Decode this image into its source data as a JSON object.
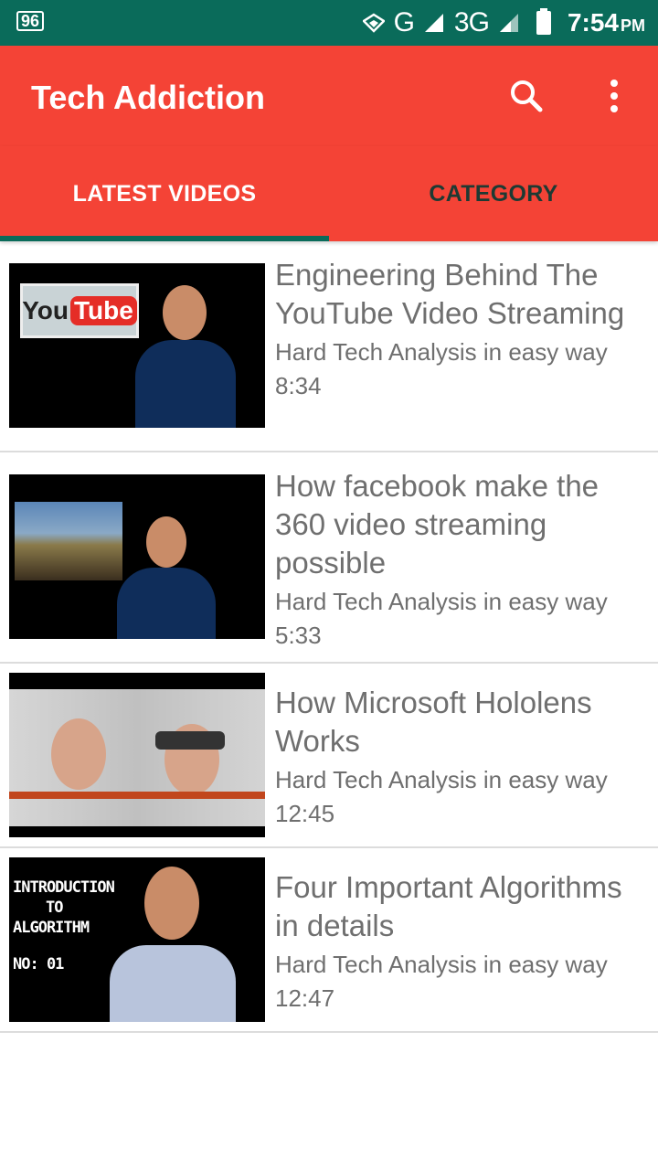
{
  "status_bar": {
    "notification": "96",
    "network_g": "G",
    "network_3g": "3G",
    "time": "7:54",
    "ampm": "PM"
  },
  "app_bar": {
    "title": "Tech Addiction",
    "icons": [
      "search-icon",
      "more-vert-icon"
    ]
  },
  "tabs": [
    {
      "label": "LATEST VIDEOS",
      "selected": true
    },
    {
      "label": "CATEGORY",
      "selected": false
    }
  ],
  "videos": [
    {
      "title": "Engineering Behind The YouTube Video Streaming",
      "channel": "Hard Tech Analysis in easy way",
      "duration": "8:34"
    },
    {
      "title": "How facebook make the 360 video streaming possible",
      "channel": "Hard Tech Analysis in easy way",
      "duration": "5:33"
    },
    {
      "title": "How Microsoft Hololens Works",
      "channel": "Hard Tech Analysis in easy way",
      "duration": "12:45"
    },
    {
      "title": "Four Important Algorithms in details",
      "channel": "Hard Tech Analysis in easy way",
      "duration": "12:47"
    }
  ],
  "thumbnails": {
    "youtube_badge_you": "You",
    "youtube_badge_tube": "Tube",
    "algo_lines": [
      "INTRODUCTION",
      "TO",
      "ALGORITHM",
      "NO: 01"
    ]
  },
  "colors": {
    "status_bar": "#0a6b5a",
    "app_bar": "#f44336",
    "tab_indicator": "#0a6b5a",
    "text_secondary": "#6f6f6f"
  }
}
